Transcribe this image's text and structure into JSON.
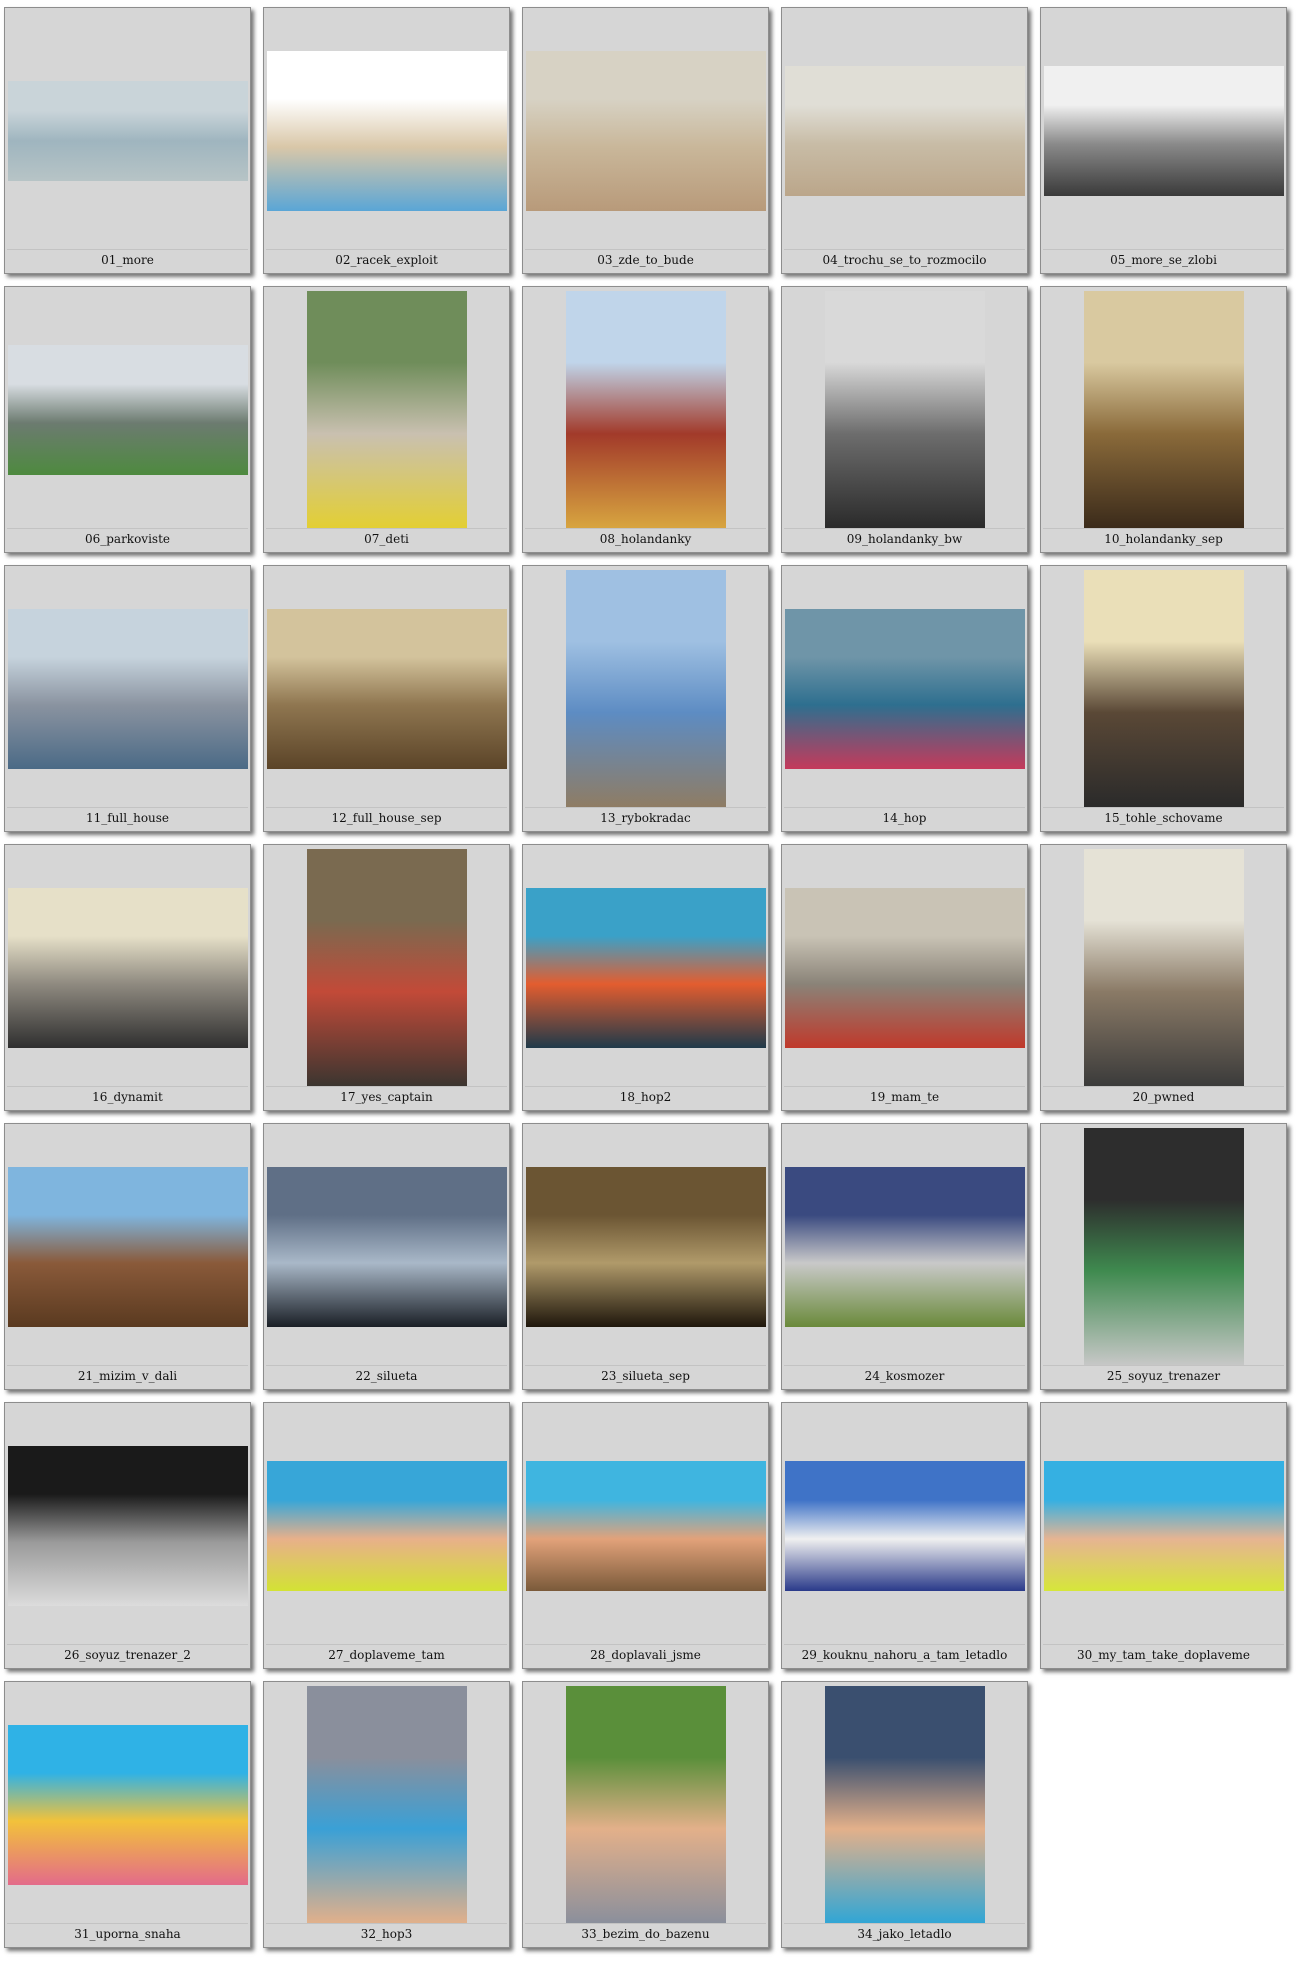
{
  "gallery": {
    "items": [
      {
        "label": "01_more",
        "shape": "wide",
        "colors": [
          "#c9d4d9",
          "#9fb5bf",
          "#b7c4c6"
        ]
      },
      {
        "label": "02_racek_exploit",
        "shape": "land",
        "colors": [
          "#ffffff",
          "#d9c7a8",
          "#5aa6d6"
        ]
      },
      {
        "label": "03_zde_to_bude",
        "shape": "land",
        "colors": [
          "#d7d2c4",
          "#c9b79a",
          "#b89a7a"
        ]
      },
      {
        "label": "04_trochu_se_to_rozmocilo",
        "shape": "wide2",
        "colors": [
          "#e0ded6",
          "#c8bca6",
          "#bba68a"
        ]
      },
      {
        "label": "05_more_se_zlobi",
        "shape": "wide2",
        "colors": [
          "#f0f0f0",
          "#8a8a8a",
          "#3a3a3a"
        ]
      },
      {
        "label": "06_parkoviste",
        "shape": "wide2",
        "colors": [
          "#d8dde2",
          "#6c7b70",
          "#4e8a3f"
        ]
      },
      {
        "label": "07_deti",
        "shape": "port",
        "colors": [
          "#6f8d5a",
          "#c9c0b0",
          "#e3cf32"
        ]
      },
      {
        "label": "08_holandanky",
        "shape": "port",
        "colors": [
          "#c0d5ea",
          "#a23a2a",
          "#d8a640"
        ]
      },
      {
        "label": "09_holandanky_bw",
        "shape": "port",
        "colors": [
          "#d9d9d9",
          "#6d6d6d",
          "#2a2a2a"
        ]
      },
      {
        "label": "10_holandanky_sep",
        "shape": "port",
        "colors": [
          "#d9c9a0",
          "#8a6a3a",
          "#3a2a1a"
        ]
      },
      {
        "label": "11_full_house",
        "shape": "land",
        "colors": [
          "#c6d3dd",
          "#8a93a0",
          "#4b6a86"
        ]
      },
      {
        "label": "12_full_house_sep",
        "shape": "land",
        "colors": [
          "#d3c39c",
          "#8f7650",
          "#5b4428"
        ]
      },
      {
        "label": "13_rybokradac",
        "shape": "port",
        "colors": [
          "#9fc0e2",
          "#5d8cc3",
          "#8f7c63"
        ]
      },
      {
        "label": "14_hop",
        "shape": "land",
        "colors": [
          "#6f95a8",
          "#2e6f8f",
          "#c53a5b"
        ]
      },
      {
        "label": "15_tohle_schovame",
        "shape": "port",
        "colors": [
          "#eadfb8",
          "#5a4836",
          "#2a2a2a"
        ]
      },
      {
        "label": "16_dynamit",
        "shape": "land",
        "colors": [
          "#e6e0c8",
          "#8f8a80",
          "#2f2f2f"
        ]
      },
      {
        "label": "17_yes_captain",
        "shape": "port",
        "colors": [
          "#7a6a50",
          "#c24a38",
          "#3a3530"
        ]
      },
      {
        "label": "18_hop2",
        "shape": "land",
        "colors": [
          "#3aa1c8",
          "#e35d2f",
          "#1f3a4a"
        ]
      },
      {
        "label": "19_mam_te",
        "shape": "land",
        "colors": [
          "#c9c3b5",
          "#8a8378",
          "#c0392b"
        ]
      },
      {
        "label": "20_pwned",
        "shape": "port",
        "colors": [
          "#e5e2d6",
          "#8a7a66",
          "#3a3a3a"
        ]
      },
      {
        "label": "21_mizim_v_dali",
        "shape": "land",
        "colors": [
          "#7fb5de",
          "#8a5a3a",
          "#5a3a20"
        ]
      },
      {
        "label": "22_silueta",
        "shape": "land",
        "colors": [
          "#5f6f86",
          "#a9b8c8",
          "#1a1f26"
        ]
      },
      {
        "label": "23_silueta_sep",
        "shape": "land",
        "colors": [
          "#6b5533",
          "#b09a6a",
          "#1f170c"
        ]
      },
      {
        "label": "24_kosmozer",
        "shape": "land",
        "colors": [
          "#3a4a80",
          "#c9c9c9",
          "#6a8a3a"
        ]
      },
      {
        "label": "25_soyuz_trenazer",
        "shape": "port",
        "colors": [
          "#2d2d2d",
          "#3f8a4f",
          "#c8c8c8"
        ]
      },
      {
        "label": "26_soyuz_trenazer_2",
        "shape": "land",
        "colors": [
          "#1a1a1a",
          "#9a9a9a",
          "#dcdcdc"
        ]
      },
      {
        "label": "27_doplaveme_tam",
        "shape": "wide2",
        "colors": [
          "#37a6d8",
          "#e8b08a",
          "#d3e234"
        ]
      },
      {
        "label": "28_doplavali_jsme",
        "shape": "wide2",
        "colors": [
          "#3fb5e0",
          "#e2a27a",
          "#7a5a3a"
        ]
      },
      {
        "label": "29_kouknu_nahoru_a_tam_letadlo",
        "shape": "wide2",
        "colors": [
          "#3f73c7",
          "#f0f0f0",
          "#2a3a8a"
        ]
      },
      {
        "label": "30_my_tam_take_doplaveme",
        "shape": "wide2",
        "colors": [
          "#35b0e2",
          "#e6b492",
          "#d6e63a"
        ]
      },
      {
        "label": "31_uporna_snaha",
        "shape": "land",
        "colors": [
          "#2fb2e6",
          "#f2c23a",
          "#e36b8a"
        ]
      },
      {
        "label": "32_hop3",
        "shape": "port",
        "colors": [
          "#8a8f9c",
          "#3aa0d6",
          "#e3b08a"
        ]
      },
      {
        "label": "33_bezim_do_bazenu",
        "shape": "port",
        "colors": [
          "#5a8f3a",
          "#e3b08a",
          "#8a8f9c"
        ]
      },
      {
        "label": "34_jako_letadlo",
        "shape": "port",
        "colors": [
          "#3a4f6f",
          "#e3b08a",
          "#2fa6d6"
        ]
      }
    ]
  }
}
